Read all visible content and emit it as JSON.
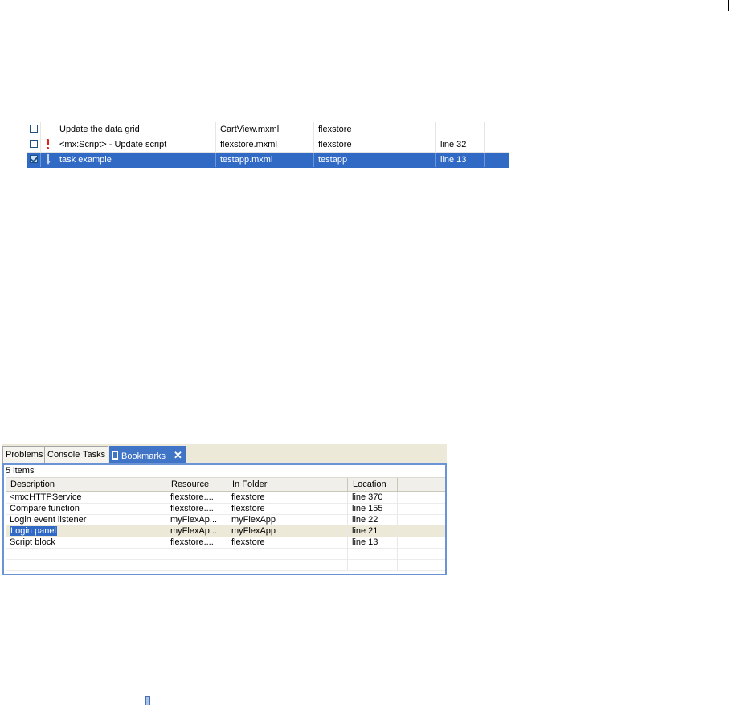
{
  "tasks_table": {
    "rows": [
      {
        "checked": false,
        "priority": "none",
        "description": "Update the data grid",
        "resource": "CartView.mxml",
        "folder": "flexstore",
        "location": "",
        "selected": false
      },
      {
        "checked": false,
        "priority": "high",
        "description": "<mx:Script> - Update script",
        "resource": "flexstore.mxml",
        "folder": "flexstore",
        "location": "line 32",
        "selected": false
      },
      {
        "checked": true,
        "priority": "low",
        "description": "task example",
        "resource": "testapp.mxml",
        "folder": "testapp",
        "location": "line 13",
        "selected": true
      }
    ]
  },
  "bookmarks_panel": {
    "tabs": [
      {
        "label": "Problems",
        "active": false
      },
      {
        "label": "Console",
        "active": false
      },
      {
        "label": "Tasks",
        "active": false
      },
      {
        "label": "Bookmarks",
        "active": true
      }
    ],
    "close_label": "✕",
    "item_count": "5 items",
    "columns": [
      "Description",
      "Resource",
      "In Folder",
      "Location"
    ],
    "rows": [
      {
        "description": "<mx:HTTPService",
        "resource": "flexstore....",
        "folder": "flexstore",
        "location": "line 370"
      },
      {
        "description": "Compare function",
        "resource": "flexstore....",
        "folder": "flexstore",
        "location": "line 155"
      },
      {
        "description": "Login event listener",
        "resource": "myFlexAp...",
        "folder": "myFlexApp",
        "location": "line 22"
      },
      {
        "description": "Login panel",
        "resource": "myFlexAp...",
        "folder": "myFlexApp",
        "location": "line 21",
        "highlighted": true
      },
      {
        "description": "Script block",
        "resource": "flexstore....",
        "folder": "flexstore",
        "location": "line 13"
      }
    ]
  },
  "colors": {
    "selection": "#316ac5",
    "active_tab": "#3f74c6",
    "panel_border": "#6a94d6",
    "priority_high": "#e51d1d",
    "priority_low": "#8aa7dc"
  },
  "icons": {
    "tab_bookmarks": "bookmark-icon",
    "standalone": "bookmark-icon"
  }
}
